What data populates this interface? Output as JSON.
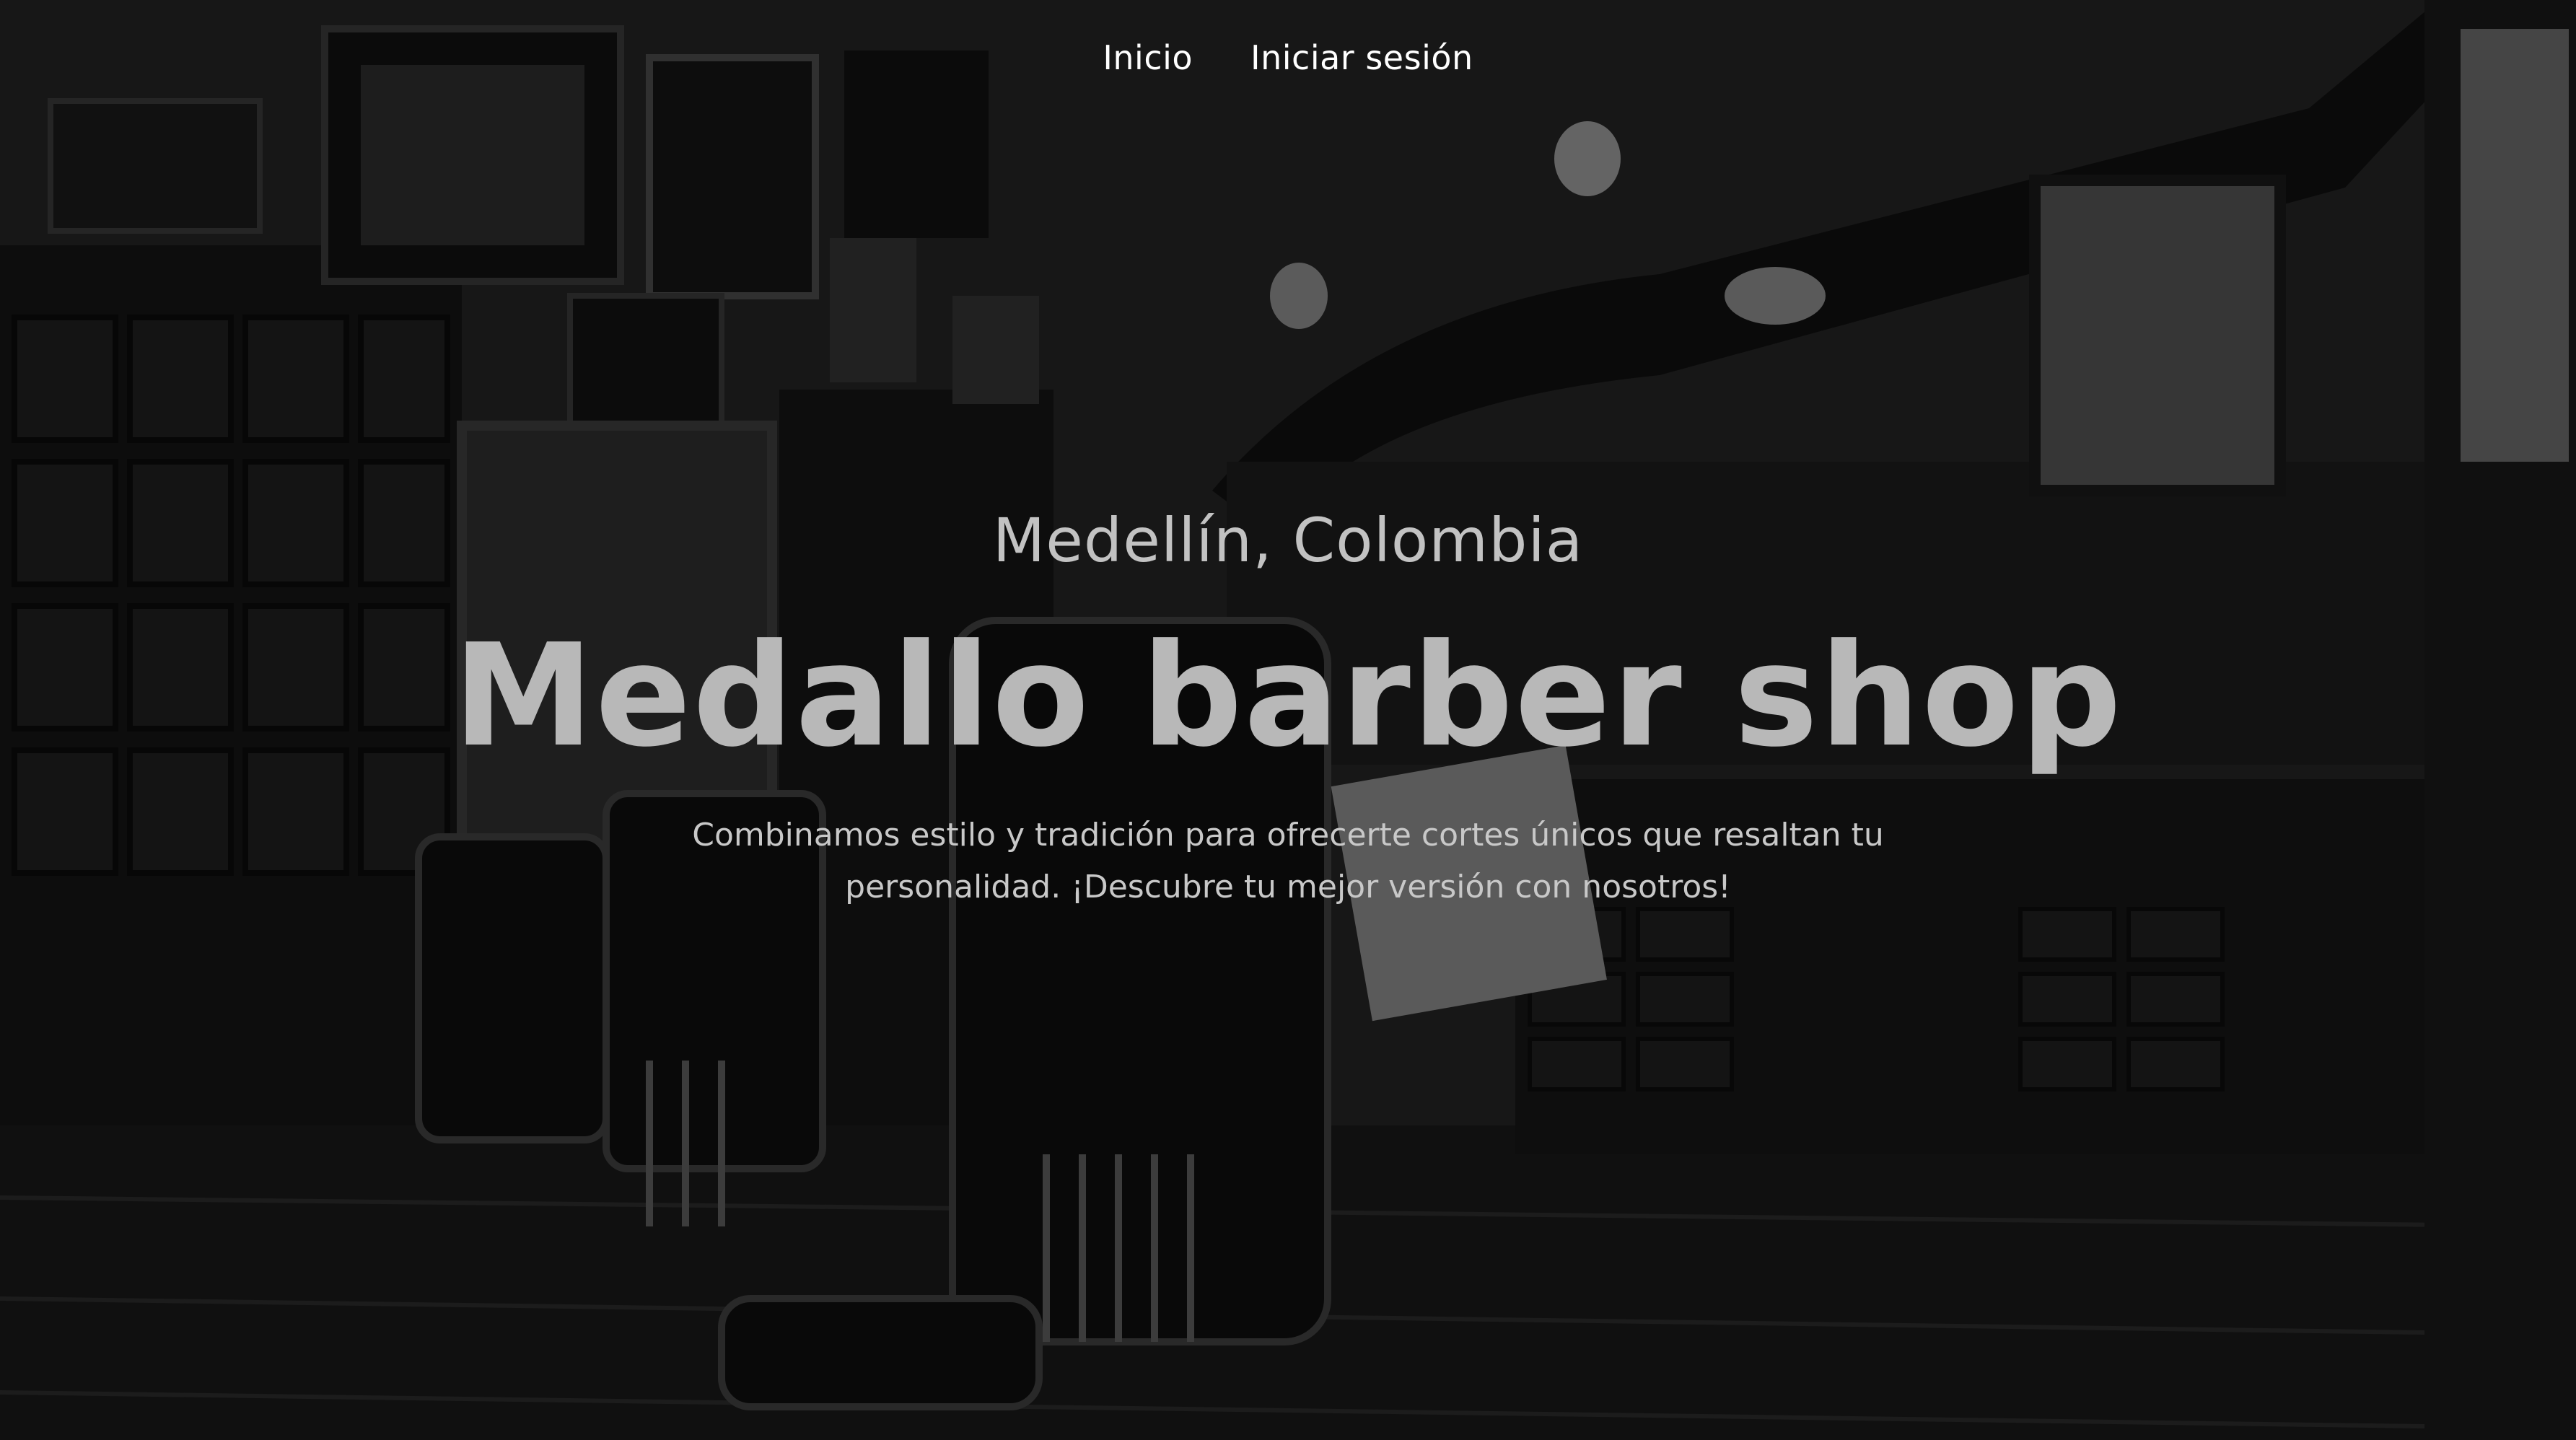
{
  "nav": {
    "items": [
      {
        "label": "Inicio"
      },
      {
        "label": "Iniciar sesión"
      }
    ]
  },
  "hero": {
    "location": "Medellín, Colombia",
    "title": "Medallo barber shop",
    "subtitle": "Combinamos estilo y tradición para ofrecerte cortes únicos que resaltan tu personalidad. ¡Descubre tu mejor versión con nosotros!",
    "background_image": "monochrome barbershop interior with barber chairs, mirrors and cabinets"
  },
  "colors": {
    "nav_text": "#ffffff",
    "title_text": "#b8b8b8",
    "body_text": "#c8c8c8",
    "background": "#1a1a1a"
  }
}
